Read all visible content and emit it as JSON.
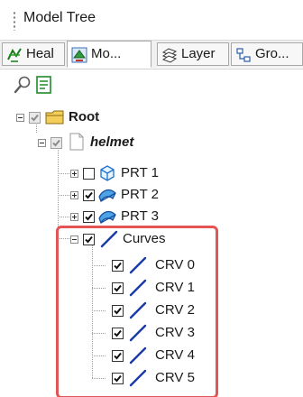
{
  "window": {
    "title": "Model Tree"
  },
  "tabs": [
    {
      "label": "Heal",
      "icon": "heal-icon",
      "active": false
    },
    {
      "label": "Mo...",
      "icon": "model-icon",
      "active": true
    },
    {
      "label": "Layer",
      "icon": "layer-icon",
      "active": false
    },
    {
      "label": "Gro...",
      "icon": "group-icon",
      "active": false
    }
  ],
  "toolbar": {
    "items": [
      {
        "icon": "search-icon"
      },
      {
        "icon": "document-icon"
      }
    ]
  },
  "tree": {
    "root": {
      "label": "Root",
      "checked": "partial"
    },
    "helmet": {
      "label": "helmet",
      "checked": "partial"
    },
    "parts": [
      {
        "label": "PRT 1",
        "checked": false
      },
      {
        "label": "PRT 2",
        "checked": true
      },
      {
        "label": "PRT 3",
        "checked": true
      }
    ],
    "curves": {
      "label": "Curves",
      "checked": true,
      "items": [
        {
          "label": "CRV 0",
          "checked": true
        },
        {
          "label": "CRV 1",
          "checked": true
        },
        {
          "label": "CRV 2",
          "checked": true
        },
        {
          "label": "CRV 3",
          "checked": true
        },
        {
          "label": "CRV 4",
          "checked": true
        },
        {
          "label": "CRV 5",
          "checked": true
        }
      ]
    }
  },
  "colors": {
    "highlight": "#e55454",
    "folder": "#f3cf5a",
    "part_blue": "#1f6fd1",
    "curve_blue": "#1a3aa8"
  }
}
